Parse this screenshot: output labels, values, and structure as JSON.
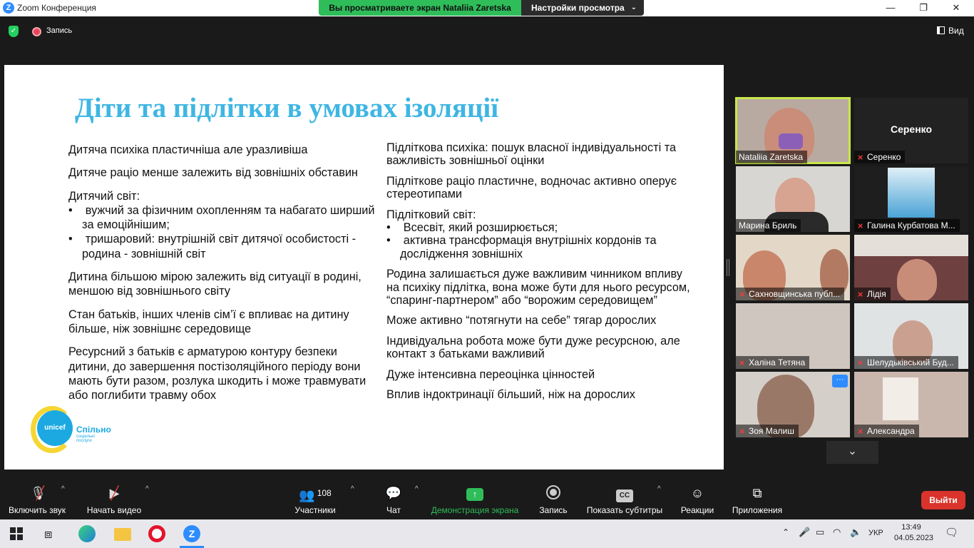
{
  "window": {
    "title": "Zoom Конференция",
    "minimize": "—",
    "maximize": "❐",
    "close": "✕"
  },
  "share_banner": {
    "viewing": "Вы просматриваете экран Nataliia Zaretska",
    "settings": "Настройки просмотра"
  },
  "topbar": {
    "record_label": "Запись",
    "view_label": "Вид"
  },
  "slide": {
    "title": "Діти та підлітки в умовах ізоляції",
    "left": {
      "p1": "Дитяча психіка пластичніша але уразливіша",
      "p2": "Дитяче раціо менше залежить від зовнішніх обставин",
      "p3_head": "Дитячий світ:",
      "p3_b1": "вужчий за фізичним охопленням та набагато ширший за емоційнішим;",
      "p3_b2": "тришаровий: внутрішній світ дитячої особистості - родина - зовнішній світ",
      "p4": "Дитина більшою мірою залежить від ситуації в родині, меншою від зовнішнього світу",
      "p5": "Стан батьків, інших членів сім’ї є впливає на дитину більше, ніж зовнішнє середовище",
      "p6": "Ресурсний з батьків є арматурою контуру безпеки дитини, до завершення постізоляційного періоду вони мають бути разом, розлука шкодить і може травмувати або поглибити травму обох"
    },
    "right": {
      "p1": "Підліткова психіка: пошук власної індивідуальності та важливість зовнішньої оцінки",
      "p2": "Підліткове раціо пластичне, водночас активно оперує стереотипами",
      "p3_head": "Підлітковий світ:",
      "p3_b1": "Всесвіт, який розширюється;",
      "p3_b2": "активна трансформація внутрішніх кордонів та дослідження зовнішніх",
      "p4": "Родина залишається дуже важливим чинником впливу на психіку підлітка, вона може бути для нього ресурсом, “спаринг-партнером” або “ворожим середовищем”",
      "p5": "Може активно “потягнути на себе” тягар дорослих",
      "p6": "Індивідуальна робота може бути дуже ресурсною, але контакт з батьками важливий",
      "p7": "Дуже інтенсивна переоцінка цінностей",
      "p8": "Вплив індоктринації більший, ніж на дорослих"
    },
    "logo": {
      "brand": "unicef",
      "partner": "Спільно",
      "partner_sub": "соціальні послуги"
    }
  },
  "participants": [
    {
      "name": "Nataliia Zaretska",
      "muted": false,
      "active": true
    },
    {
      "name": "Серенко",
      "muted": true,
      "video": false
    },
    {
      "name": "Марина Бриль",
      "muted": false
    },
    {
      "name": "Галина Курбатова М...",
      "muted": true
    },
    {
      "name": "Сахновщинська публ...",
      "muted": true
    },
    {
      "name": "Лідія",
      "muted": true
    },
    {
      "name": "Халіна Тетяна",
      "muted": true
    },
    {
      "name": "Шелудьківський Буд...",
      "muted": true
    },
    {
      "name": "Зоя Малиш",
      "muted": true
    },
    {
      "name": "Александра",
      "muted": true
    }
  ],
  "toolbar": {
    "unmute": "Включить звук",
    "start_video": "Начать видео",
    "participants": "Участники",
    "participants_count": "108",
    "chat": "Чат",
    "share": "Демонстрация экрана",
    "record": "Запись",
    "captions": "Показать субтитры",
    "reactions": "Реакции",
    "apps": "Приложения",
    "leave": "Выйти"
  },
  "taskbar": {
    "time": "13:49",
    "date": "04.05.2023",
    "lang": "УКР"
  },
  "colors": {
    "share_green": "#2fbd5a",
    "slide_title": "#3fb6e3",
    "leave_red": "#d9332b",
    "active_speaker": "#c8e64a"
  }
}
